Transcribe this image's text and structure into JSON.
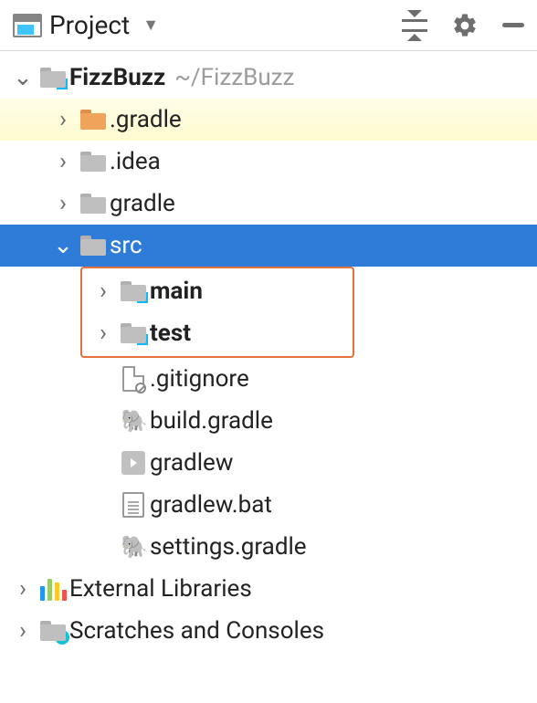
{
  "header": {
    "title": "Project"
  },
  "tree": {
    "root": {
      "name": "FizzBuzz",
      "path": "~/FizzBuzz"
    },
    "items": [
      {
        "label": ".gradle"
      },
      {
        "label": ".idea"
      },
      {
        "label": "gradle"
      },
      {
        "label": "src",
        "children": [
          {
            "label": "main"
          },
          {
            "label": "test"
          }
        ]
      },
      {
        "label": ".gitignore"
      },
      {
        "label": "build.gradle"
      },
      {
        "label": "gradlew"
      },
      {
        "label": "gradlew.bat"
      },
      {
        "label": "settings.gradle"
      }
    ],
    "external": "External Libraries",
    "scratches": "Scratches and Consoles"
  }
}
